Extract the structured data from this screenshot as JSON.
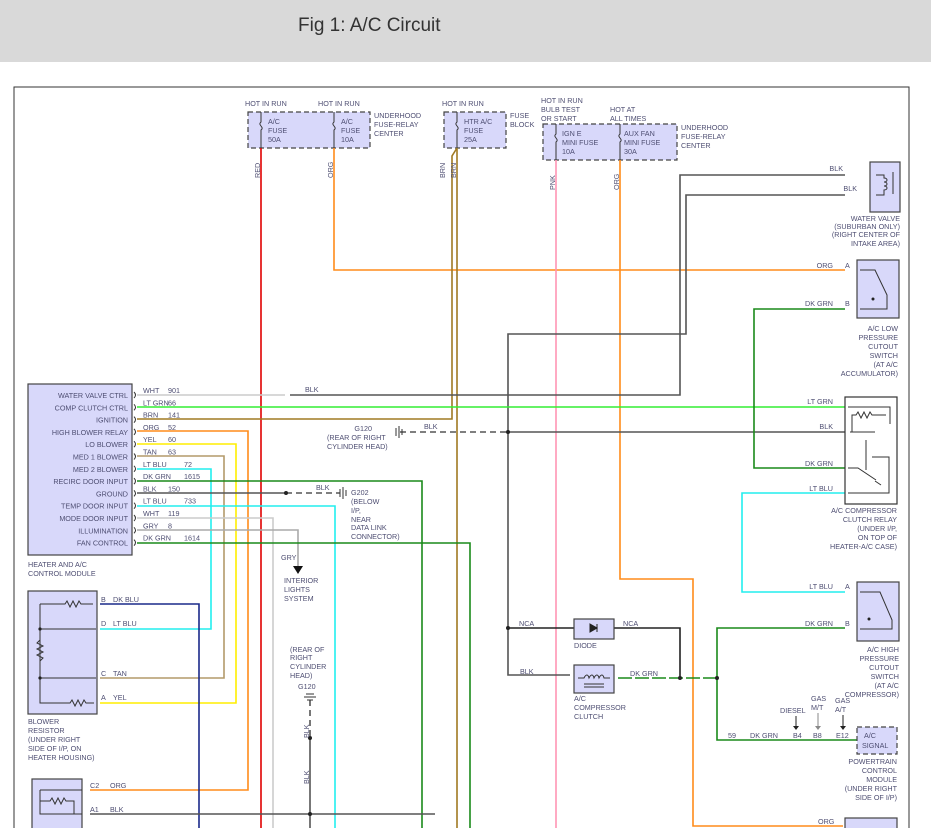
{
  "title": "Fig 1: A/C Circuit",
  "fuses": {
    "hot_in_run": "HOT IN RUN",
    "ac_fuse_50": [
      "A/C",
      "FUSE",
      "50A"
    ],
    "ac_fuse_10": [
      "A/C",
      "FUSE",
      "10A"
    ],
    "underhood_1": [
      "UNDERHOOD",
      "FUSE-RELAY",
      "CENTER"
    ],
    "htr_fuse": [
      "HTR A/C",
      "FUSE",
      "25A"
    ],
    "fuse_block": [
      "FUSE",
      "BLOCK"
    ],
    "bulb_test": [
      "HOT IN RUN",
      "BULB TEST",
      "OR START"
    ],
    "hot_all_times": [
      "HOT AT",
      "ALL TIMES"
    ],
    "ign_e": [
      "IGN E",
      "MINI FUSE",
      "10A"
    ],
    "aux_fan": [
      "AUX FAN",
      "MINI FUSE",
      "30A"
    ],
    "underhood_2": [
      "UNDERHOOD",
      "FUSE-RELAY",
      "CENTER"
    ]
  },
  "wire_labels": {
    "red": "RED",
    "org": "ORG",
    "brn": "BRN",
    "pnk": "PNK",
    "blk": "BLK",
    "lt_grn": "LT GRN",
    "dk_grn": "DK GRN",
    "lt_blu": "LT BLU",
    "nca": "NCA",
    "gry": "GRY",
    "dk_blu": "DK BLU",
    "tan": "TAN",
    "yel": "YEL"
  },
  "colors": {
    "red": "#e00000",
    "org": "#ff8c1a",
    "brn": "#a07a22",
    "pnk": "#ff94b4",
    "blk": "#555555",
    "lt_grn": "#33ee33",
    "dk_grn": "#1a8a1a",
    "lt_blu": "#22eeee",
    "yel": "#ffee00",
    "tan": "#b39a6a",
    "dk_blu": "#1a2a8a",
    "wht": "#cccccc",
    "gry": "#aaaaaa",
    "component": "#d8d8fa"
  },
  "module": {
    "name": [
      "HEATER AND A/C",
      "CONTROL MODULE"
    ],
    "rows": [
      {
        "label": "WATER VALVE CTRL",
        "wire": "WHT",
        "circuit": "901"
      },
      {
        "label": "COMP CLUTCH CTRL",
        "wire": "LT GRN",
        "circuit": "66"
      },
      {
        "label": "IGNITION",
        "wire": "BRN",
        "circuit": "141"
      },
      {
        "label": "HIGH BLOWER RELAY",
        "wire": "ORG",
        "circuit": "52"
      },
      {
        "label": "LO BLOWER",
        "wire": "YEL",
        "circuit": "60"
      },
      {
        "label": "MED 1 BLOWER",
        "wire": "TAN",
        "circuit": "63"
      },
      {
        "label": "MED 2 BLOWER",
        "wire": "LT BLU",
        "circuit": "72"
      },
      {
        "label": "RECIRC DOOR INPUT",
        "wire": "DK GRN",
        "circuit": "1615"
      },
      {
        "label": "GROUND",
        "wire": "BLK",
        "circuit": "150"
      },
      {
        "label": "TEMP DOOR INPUT",
        "wire": "LT BLU",
        "circuit": "733"
      },
      {
        "label": "MODE DOOR INPUT",
        "wire": "WHT",
        "circuit": "119"
      },
      {
        "label": "ILLUMINATION",
        "wire": "GRY",
        "circuit": "8"
      },
      {
        "label": "FAN CONTROL",
        "wire": "DK GRN",
        "circuit": "1614"
      }
    ]
  },
  "grounds": {
    "g120_a": [
      "G120",
      "(REAR OF RIGHT",
      "CYLINDER HEAD)"
    ],
    "g202": [
      "G202",
      "(BELOW",
      "I/P,",
      "NEAR",
      "DATA LINK",
      "CONNECTOR)"
    ],
    "g120_b": [
      "(REAR OF",
      "RIGHT",
      "CYLINDER",
      "HEAD)",
      "G120"
    ]
  },
  "interior_lights": [
    "INTERIOR",
    "LIGHTS",
    "SYSTEM"
  ],
  "water_valve": [
    "WATER VALVE",
    "(SUBURBAN ONLY)",
    "(RIGHT CENTER OF",
    "INTAKE AREA)"
  ],
  "low_switch": {
    "pins": [
      "A",
      "B"
    ],
    "name": [
      "A/C LOW",
      "PRESSURE",
      "CUTOUT",
      "SWITCH",
      "(AT A/C",
      "ACCUMULATOR)"
    ]
  },
  "relay": [
    "A/C COMPRESSOR",
    "CLUTCH RELAY",
    "(UNDER I/P,",
    "ON TOP OF",
    "HEATER-A/C CASE)"
  ],
  "high_switch": {
    "pins": [
      "A",
      "B"
    ],
    "name": [
      "A/C HIGH",
      "PRESSURE",
      "CUTOUT",
      "SWITCH",
      "(AT A/C",
      "COMPRESSOR)"
    ]
  },
  "diode": "DIODE",
  "clutch": [
    "A/C",
    "COMPRESSOR",
    "CLUTCH"
  ],
  "pcm": {
    "box": [
      "A/C",
      "SIGNAL"
    ],
    "name": [
      "POWERTRAIN",
      "CONTROL",
      "MODULE",
      "(UNDER RIGHT",
      "SIDE OF I/P)"
    ],
    "variants": [
      {
        "label": [
          "DIESEL"
        ],
        "pin": "B4"
      },
      {
        "label": [
          "GAS",
          "M/T"
        ],
        "pin": "B8"
      },
      {
        "label": [
          "GAS",
          "A/T"
        ],
        "pin": "E12"
      }
    ],
    "circuit": "59"
  },
  "blower_resistor": {
    "pins": [
      "B",
      "D",
      "C",
      "A"
    ],
    "name": [
      "BLOWER",
      "RESISTOR",
      "(UNDER RIGHT",
      "SIDE OF I/P, ON",
      "HEATER HOUSING)"
    ]
  },
  "bottom_comp": {
    "pins": [
      "C2",
      "A1"
    ]
  }
}
